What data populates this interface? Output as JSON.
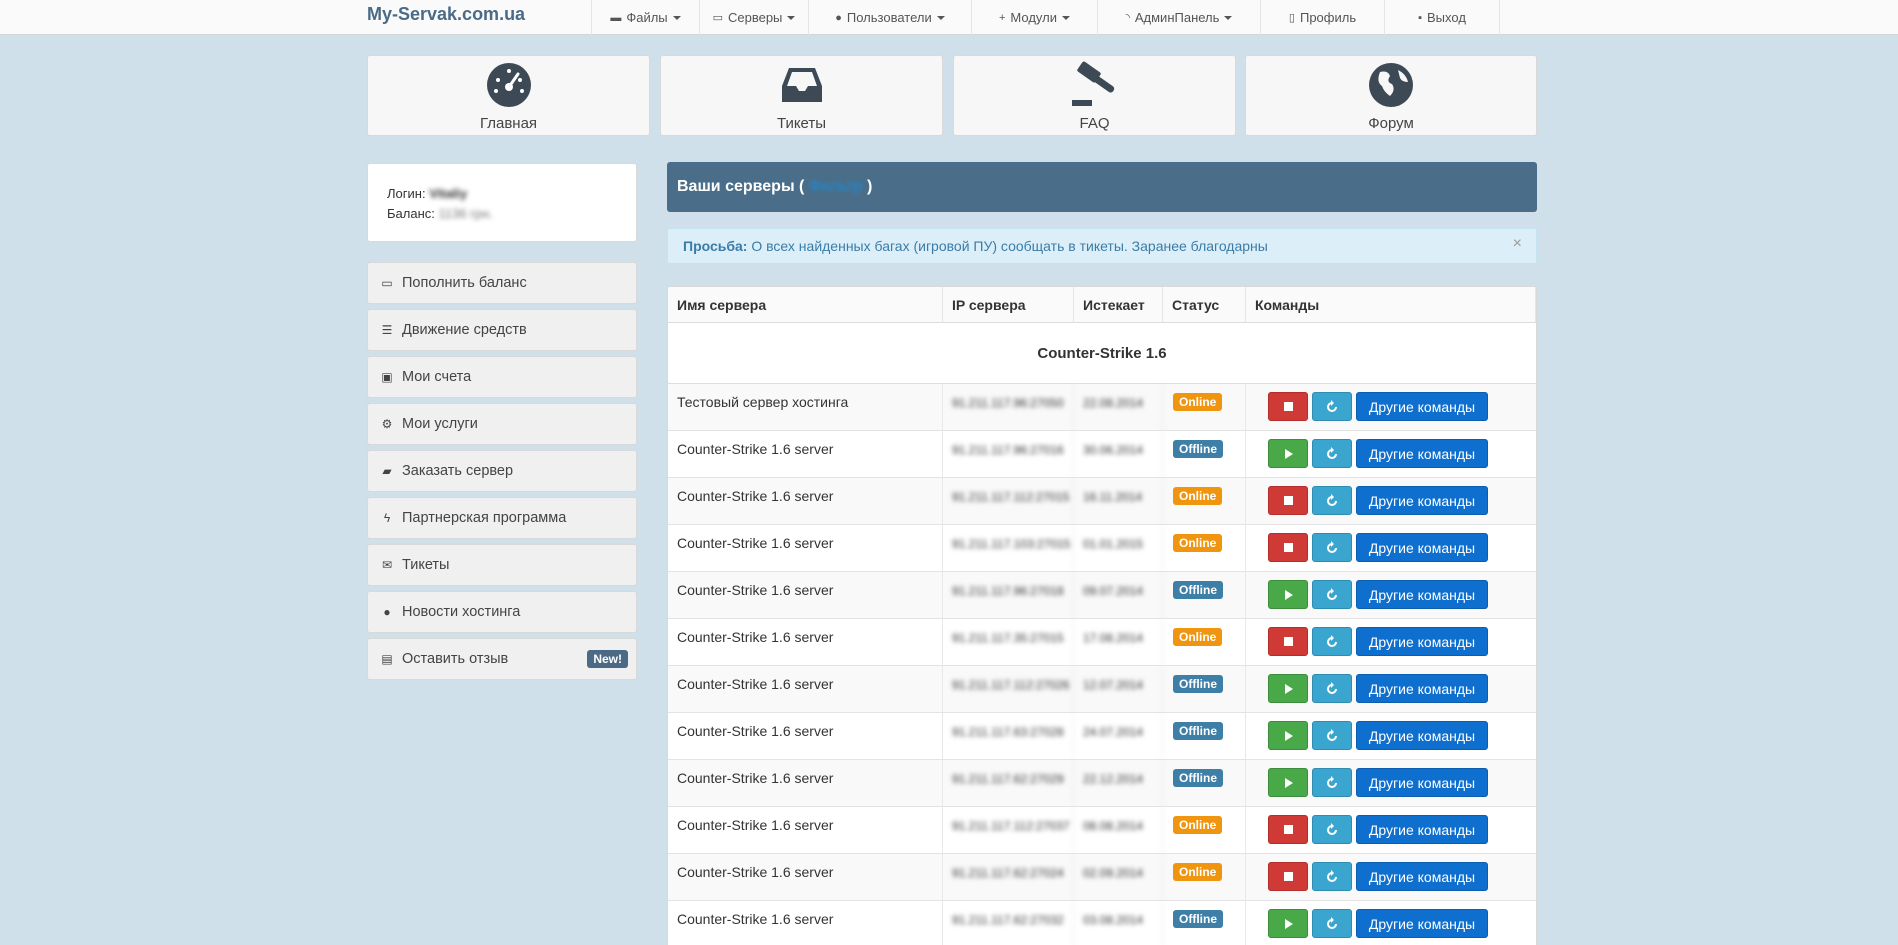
{
  "brand": "My-Servak.com.ua",
  "nav": [
    {
      "label": "Файлы",
      "icon": "folder-icon",
      "glyph": "▬",
      "caret": true,
      "w": 108
    },
    {
      "label": "Серверы",
      "icon": "drive-icon",
      "glyph": "▭",
      "caret": true,
      "w": 109
    },
    {
      "label": "Пользователи",
      "icon": "user-icon",
      "glyph": "●",
      "caret": true,
      "w": 163
    },
    {
      "label": "Модули",
      "icon": "plus-icon",
      "glyph": "+",
      "caret": true,
      "w": 126
    },
    {
      "label": "АдминПанель",
      "icon": "rss-icon",
      "glyph": "◝",
      "caret": true,
      "w": 163
    },
    {
      "label": "Профиль",
      "icon": "file-icon",
      "glyph": "▯",
      "caret": false,
      "w": 124
    },
    {
      "label": "Выход",
      "icon": "lock-icon",
      "glyph": "▪",
      "caret": false,
      "w": 116
    }
  ],
  "tiles": [
    {
      "label": "Главная",
      "icon": "dashboard-icon"
    },
    {
      "label": "Тикеты",
      "icon": "inbox-icon"
    },
    {
      "label": "FAQ",
      "icon": "gavel-icon"
    },
    {
      "label": "Форум",
      "icon": "globe-icon"
    }
  ],
  "account": {
    "login_label": "Логин:",
    "login_value": "Vitaliy",
    "balance_label": "Баланс:",
    "balance_value": "1136 грн."
  },
  "sidebar": [
    {
      "label": "Пополнить баланс",
      "icon": "credit-card-icon",
      "glyph": "▭"
    },
    {
      "label": "Движение средств",
      "icon": "list-icon",
      "glyph": "☰"
    },
    {
      "label": "Мои счета",
      "icon": "money-icon",
      "glyph": "▣"
    },
    {
      "label": "Мои услуги",
      "icon": "cogs-icon",
      "glyph": "⚙"
    },
    {
      "label": "Заказать сервер",
      "icon": "truck-icon",
      "glyph": "▰"
    },
    {
      "label": "Партнерская программа",
      "icon": "bolt-icon",
      "glyph": "ϟ"
    },
    {
      "label": "Тикеты",
      "icon": "envelope-icon",
      "glyph": "✉"
    },
    {
      "label": "Новости хостинга",
      "icon": "globe-small-icon",
      "glyph": "●"
    },
    {
      "label": "Оставить отзыв",
      "icon": "comment-card-icon",
      "glyph": "▤",
      "badge": "New!"
    }
  ],
  "panel": {
    "title_prefix": "Ваши серверы (",
    "filter": "Фильтр",
    "title_suffix": ")"
  },
  "alert": {
    "bold": "Просьба:",
    "text": " О всех найденных багах (игровой ПУ) сообщать в тикеты. Заранее благодарны",
    "close": "×"
  },
  "table": {
    "headers": [
      "Имя сервера",
      "IP сервера",
      "Истекает",
      "Статус",
      "Команды"
    ],
    "group": "Counter-Strike 1.6",
    "other_label": "Другие команды",
    "rows": [
      {
        "name": "Тестовый сервер хостинга",
        "ip": "91.211.117.96:27050",
        "exp": "22.08.2014",
        "status": "Online"
      },
      {
        "name": "Counter-Strike 1.6 server",
        "ip": "91.211.117.96:27016",
        "exp": "30.06.2014",
        "status": "Offline"
      },
      {
        "name": "Counter-Strike 1.6 server",
        "ip": "91.211.117.112:27015",
        "exp": "16.11.2014",
        "status": "Online"
      },
      {
        "name": "Counter-Strike 1.6 server",
        "ip": "91.211.117.103:27015",
        "exp": "01.01.2015",
        "status": "Online"
      },
      {
        "name": "Counter-Strike 1.6 server",
        "ip": "91.211.117.96:27018",
        "exp": "09.07.2014",
        "status": "Offline"
      },
      {
        "name": "Counter-Strike 1.6 server",
        "ip": "91.211.117.35:27015",
        "exp": "17.08.2014",
        "status": "Online"
      },
      {
        "name": "Counter-Strike 1.6 server",
        "ip": "91.211.117.112:27026",
        "exp": "12.07.2014",
        "status": "Offline"
      },
      {
        "name": "Counter-Strike 1.6 server",
        "ip": "91.211.117.63:27028",
        "exp": "24.07.2014",
        "status": "Offline"
      },
      {
        "name": "Counter-Strike 1.6 server",
        "ip": "91.211.117.62:27029",
        "exp": "22.12.2014",
        "status": "Offline"
      },
      {
        "name": "Counter-Strike 1.6 server",
        "ip": "91.211.117.112:27037",
        "exp": "08.08.2014",
        "status": "Online"
      },
      {
        "name": "Counter-Strike 1.6 server",
        "ip": "91.211.117.62:27024",
        "exp": "02.09.2014",
        "status": "Online"
      },
      {
        "name": "Counter-Strike 1.6 server",
        "ip": "91.211.117.62:27032",
        "exp": "03.08.2014",
        "status": "Offline"
      }
    ]
  },
  "colors": {
    "page_bg": "#cfe0ea",
    "panel_head": "#4a6e89",
    "online": "#f0950f",
    "offline": "#3d7fa6",
    "stop": "#cf3a36",
    "play": "#49a847",
    "restart": "#3aa6cf",
    "other": "#0f6fce"
  }
}
